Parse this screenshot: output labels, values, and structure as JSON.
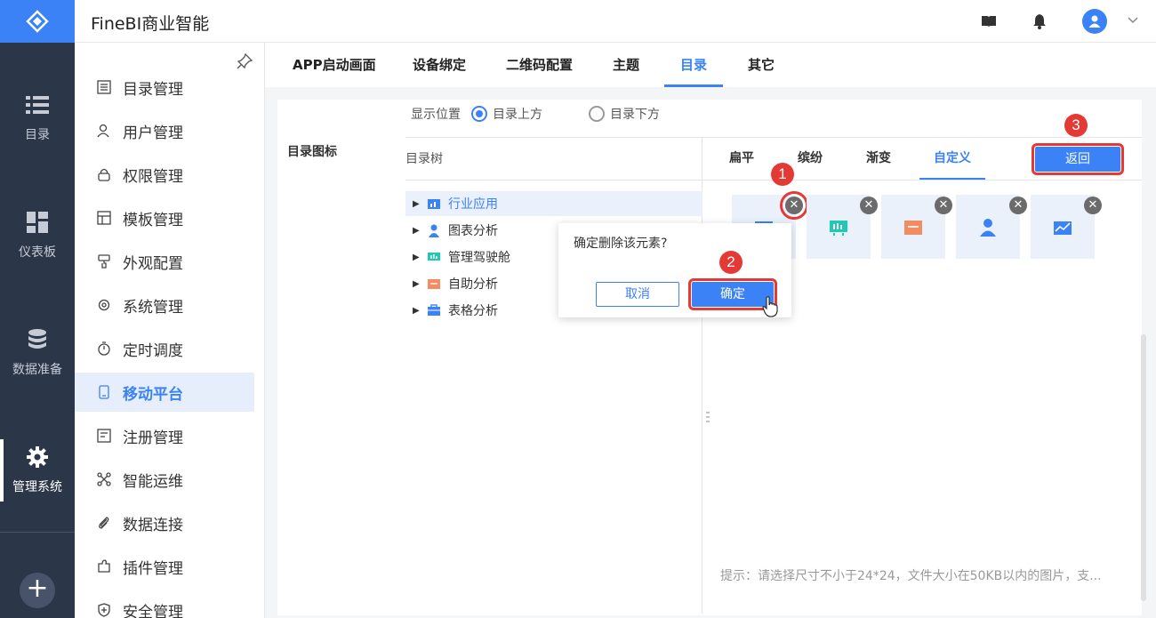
{
  "app": {
    "title": "FineBI商业智能"
  },
  "rail": {
    "items": [
      {
        "label": "目录",
        "icon": "list-icon"
      },
      {
        "label": "仪表板",
        "icon": "dashboard-icon"
      },
      {
        "label": "数据准备",
        "icon": "database-icon"
      },
      {
        "label": "管理系统",
        "icon": "gear-icon",
        "active": true
      }
    ],
    "add_label": "+"
  },
  "sidebar": {
    "items": [
      {
        "label": "目录管理",
        "icon": "directory-icon"
      },
      {
        "label": "用户管理",
        "icon": "user-icon"
      },
      {
        "label": "权限管理",
        "icon": "lock-icon"
      },
      {
        "label": "模板管理",
        "icon": "template-icon"
      },
      {
        "label": "外观配置",
        "icon": "brush-icon"
      },
      {
        "label": "系统管理",
        "icon": "settings-icon"
      },
      {
        "label": "定时调度",
        "icon": "timer-icon"
      },
      {
        "label": "移动平台",
        "icon": "mobile-icon",
        "active": true
      },
      {
        "label": "注册管理",
        "icon": "register-icon"
      },
      {
        "label": "智能运维",
        "icon": "ops-icon"
      },
      {
        "label": "数据连接",
        "icon": "link-icon"
      },
      {
        "label": "插件管理",
        "icon": "plugin-icon"
      },
      {
        "label": "安全管理",
        "icon": "shield-icon"
      }
    ]
  },
  "tabs": [
    "APP启动画面",
    "设备绑定",
    "二维码配置",
    "主题",
    "目录",
    "其它"
  ],
  "active_tab": "目录",
  "display_position": {
    "label": "显示位置",
    "options": [
      "目录上方",
      "目录下方"
    ],
    "selected": "目录上方"
  },
  "section_label": "目录图标",
  "tree": {
    "header": "目录树",
    "nodes": [
      {
        "label": "行业应用",
        "color": "#3b82f6",
        "selected": true
      },
      {
        "label": "图表分析",
        "color": "#3b82f6"
      },
      {
        "label": "管理驾驶舱",
        "color": "#1fc9b6"
      },
      {
        "label": "自助分析",
        "color": "#f28c62"
      },
      {
        "label": "表格分析",
        "color": "#3b82f6"
      }
    ]
  },
  "style_tabs": [
    "扁平",
    "缤纷",
    "渐变",
    "自定义"
  ],
  "active_style_tab": "自定义",
  "back_button": "返回",
  "tiles": [
    {
      "icon": "industry-icon",
      "color": "#3b82f6"
    },
    {
      "icon": "cockpit-icon",
      "color": "#1fc9b6"
    },
    {
      "icon": "folder-icon",
      "color": "#f28c62"
    },
    {
      "icon": "person-icon",
      "color": "#3b82f6"
    },
    {
      "icon": "chart-icon",
      "color": "#3b82f6"
    }
  ],
  "tip": "提示：请选择尺寸不小于24*24，文件大小在50KB以内的图片，支...",
  "confirm_dialog": {
    "message": "确定删除该元素?",
    "cancel": "取消",
    "ok": "确定"
  },
  "markers": [
    "1",
    "2",
    "3"
  ],
  "colors": {
    "accent": "#3b82f6",
    "rail": "#2c3649",
    "highlight": "#e53935"
  }
}
